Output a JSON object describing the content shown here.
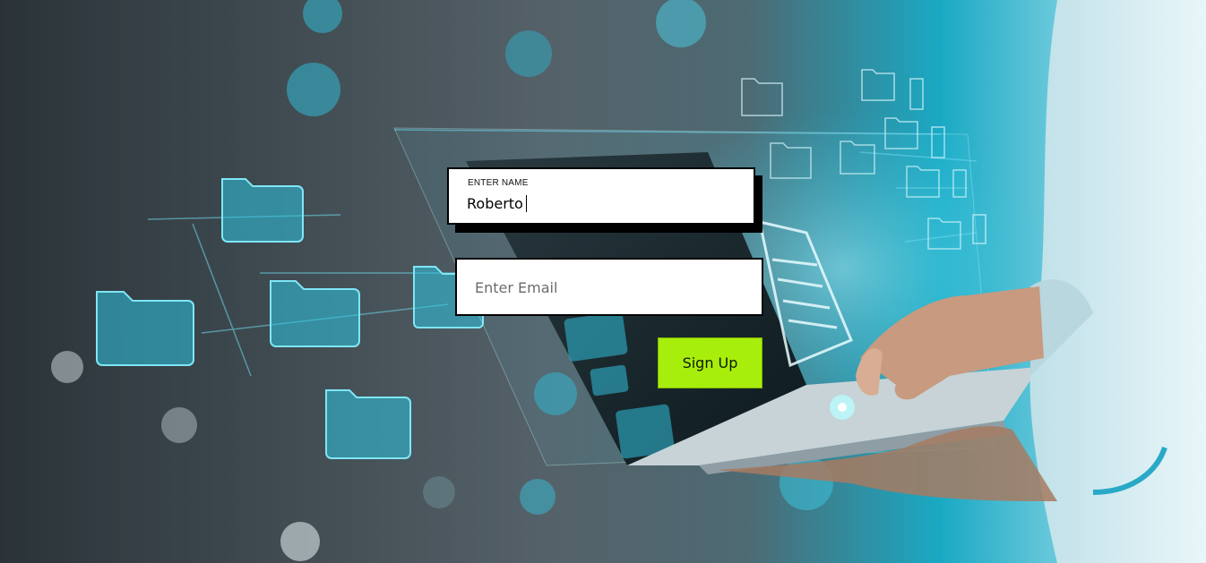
{
  "form": {
    "name_label": "ENTER NAME",
    "name_value": "Roberto",
    "email_placeholder": "Enter Email",
    "email_value": "",
    "signup_label": "Sign Up"
  },
  "colors": {
    "button_background": "#a8ee0c",
    "field_background": "#ffffff",
    "field_border": "#000000",
    "accent_cyan": "#22c6e0"
  },
  "background": {
    "image_subject": "person holding laptop with floating holographic folder and document icons"
  }
}
